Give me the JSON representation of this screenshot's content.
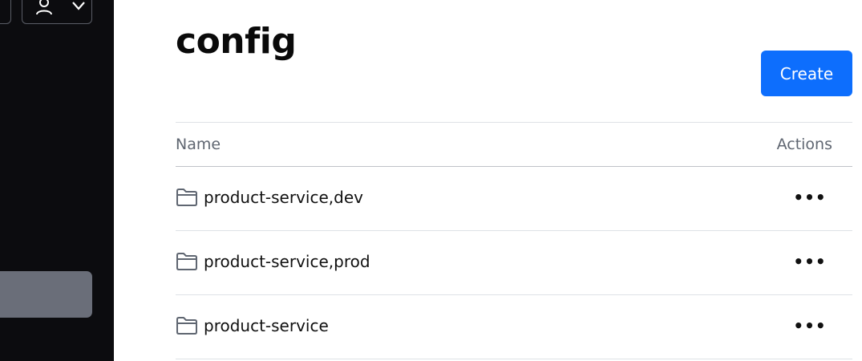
{
  "page": {
    "title": "config"
  },
  "toolbar": {
    "create_label": "Create"
  },
  "table": {
    "columns": {
      "name": "Name",
      "actions": "Actions"
    },
    "rows": [
      {
        "name": "product-service,dev",
        "icon": "folder-icon",
        "actions_label": "•••"
      },
      {
        "name": "product-service,prod",
        "icon": "folder-icon",
        "actions_label": "•••"
      },
      {
        "name": "product-service",
        "icon": "folder-icon",
        "actions_label": "•••"
      }
    ]
  },
  "colors": {
    "sidebar_bg": "#0c0c0f",
    "sidebar_active": "#6a6e79",
    "primary": "#0d6efd",
    "header_text": "#5f6671"
  }
}
